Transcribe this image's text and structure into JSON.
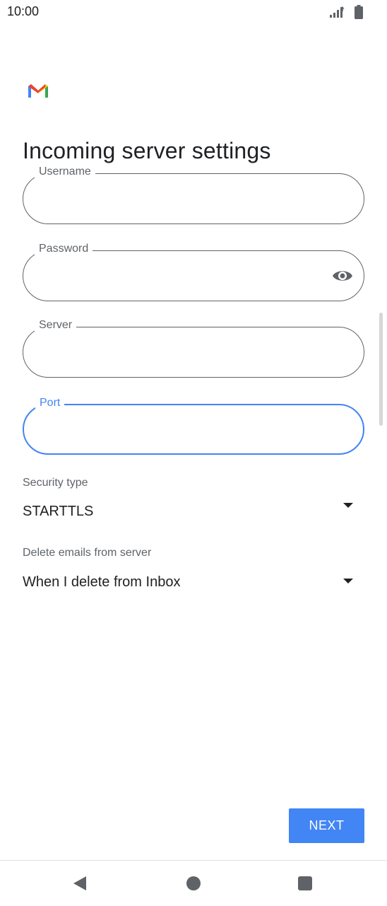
{
  "status": {
    "time": "10:00",
    "icons": [
      "signal-icon",
      "battery-icon"
    ]
  },
  "app": {
    "logo": "gmail-logo",
    "title": "Incoming server settings"
  },
  "fields": {
    "username": {
      "label": "Username",
      "value": ""
    },
    "password": {
      "label": "Password",
      "value": "",
      "toggle_icon": "eye-icon"
    },
    "server": {
      "label": "Server",
      "value": ""
    },
    "port": {
      "label": "Port",
      "value": ""
    }
  },
  "security_type": {
    "label": "Security type",
    "value": "STARTTLS"
  },
  "delete_emails": {
    "label": "Delete emails from server",
    "value": "When I delete from Inbox"
  },
  "actions": {
    "next_label": "NEXT"
  },
  "colors": {
    "accent": "#4285f4",
    "outline": "#5f6368",
    "text": "#202124"
  }
}
